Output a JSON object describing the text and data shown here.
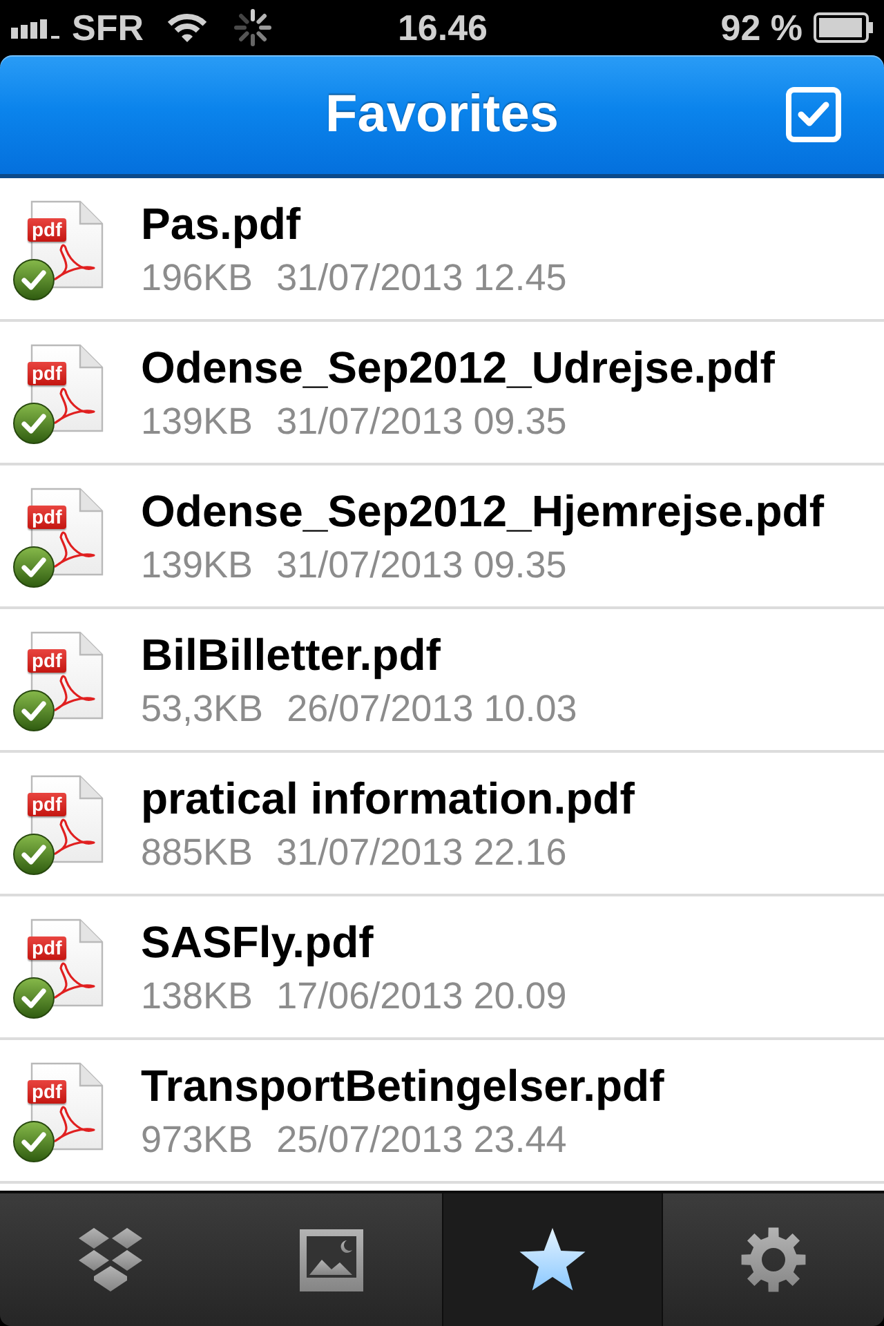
{
  "status_bar": {
    "carrier": "SFR",
    "time": "16.46",
    "battery": "92 %"
  },
  "nav_bar": {
    "title": "Favorites"
  },
  "files": [
    {
      "name": "Pas.pdf",
      "type": "pdf",
      "size": "196KB",
      "modified": "31/07/2013 12.45",
      "downloaded": true
    },
    {
      "name": "Odense_Sep2012_Udrejse.pdf",
      "type": "pdf",
      "size": "139KB",
      "modified": "31/07/2013 09.35",
      "downloaded": true
    },
    {
      "name": "Odense_Sep2012_Hjemrejse.pdf",
      "type": "pdf",
      "size": "139KB",
      "modified": "31/07/2013 09.35",
      "downloaded": true
    },
    {
      "name": "BilBilletter.pdf",
      "type": "pdf",
      "size": "53,3KB",
      "modified": "26/07/2013 10.03",
      "downloaded": true
    },
    {
      "name": "pratical information.pdf",
      "type": "pdf",
      "size": "885KB",
      "modified": "31/07/2013 22.16",
      "downloaded": true
    },
    {
      "name": "SASFly.pdf",
      "type": "pdf",
      "size": "138KB",
      "modified": "17/06/2013 20.09",
      "downloaded": true
    },
    {
      "name": "TransportBetingelser.pdf",
      "type": "pdf",
      "size": "973KB",
      "modified": "25/07/2013 23.44",
      "downloaded": true
    }
  ],
  "tabs": [
    {
      "kind": "files",
      "selected": false
    },
    {
      "kind": "photos",
      "selected": false
    },
    {
      "kind": "favorites",
      "selected": true
    },
    {
      "kind": "settings",
      "selected": false
    }
  ]
}
